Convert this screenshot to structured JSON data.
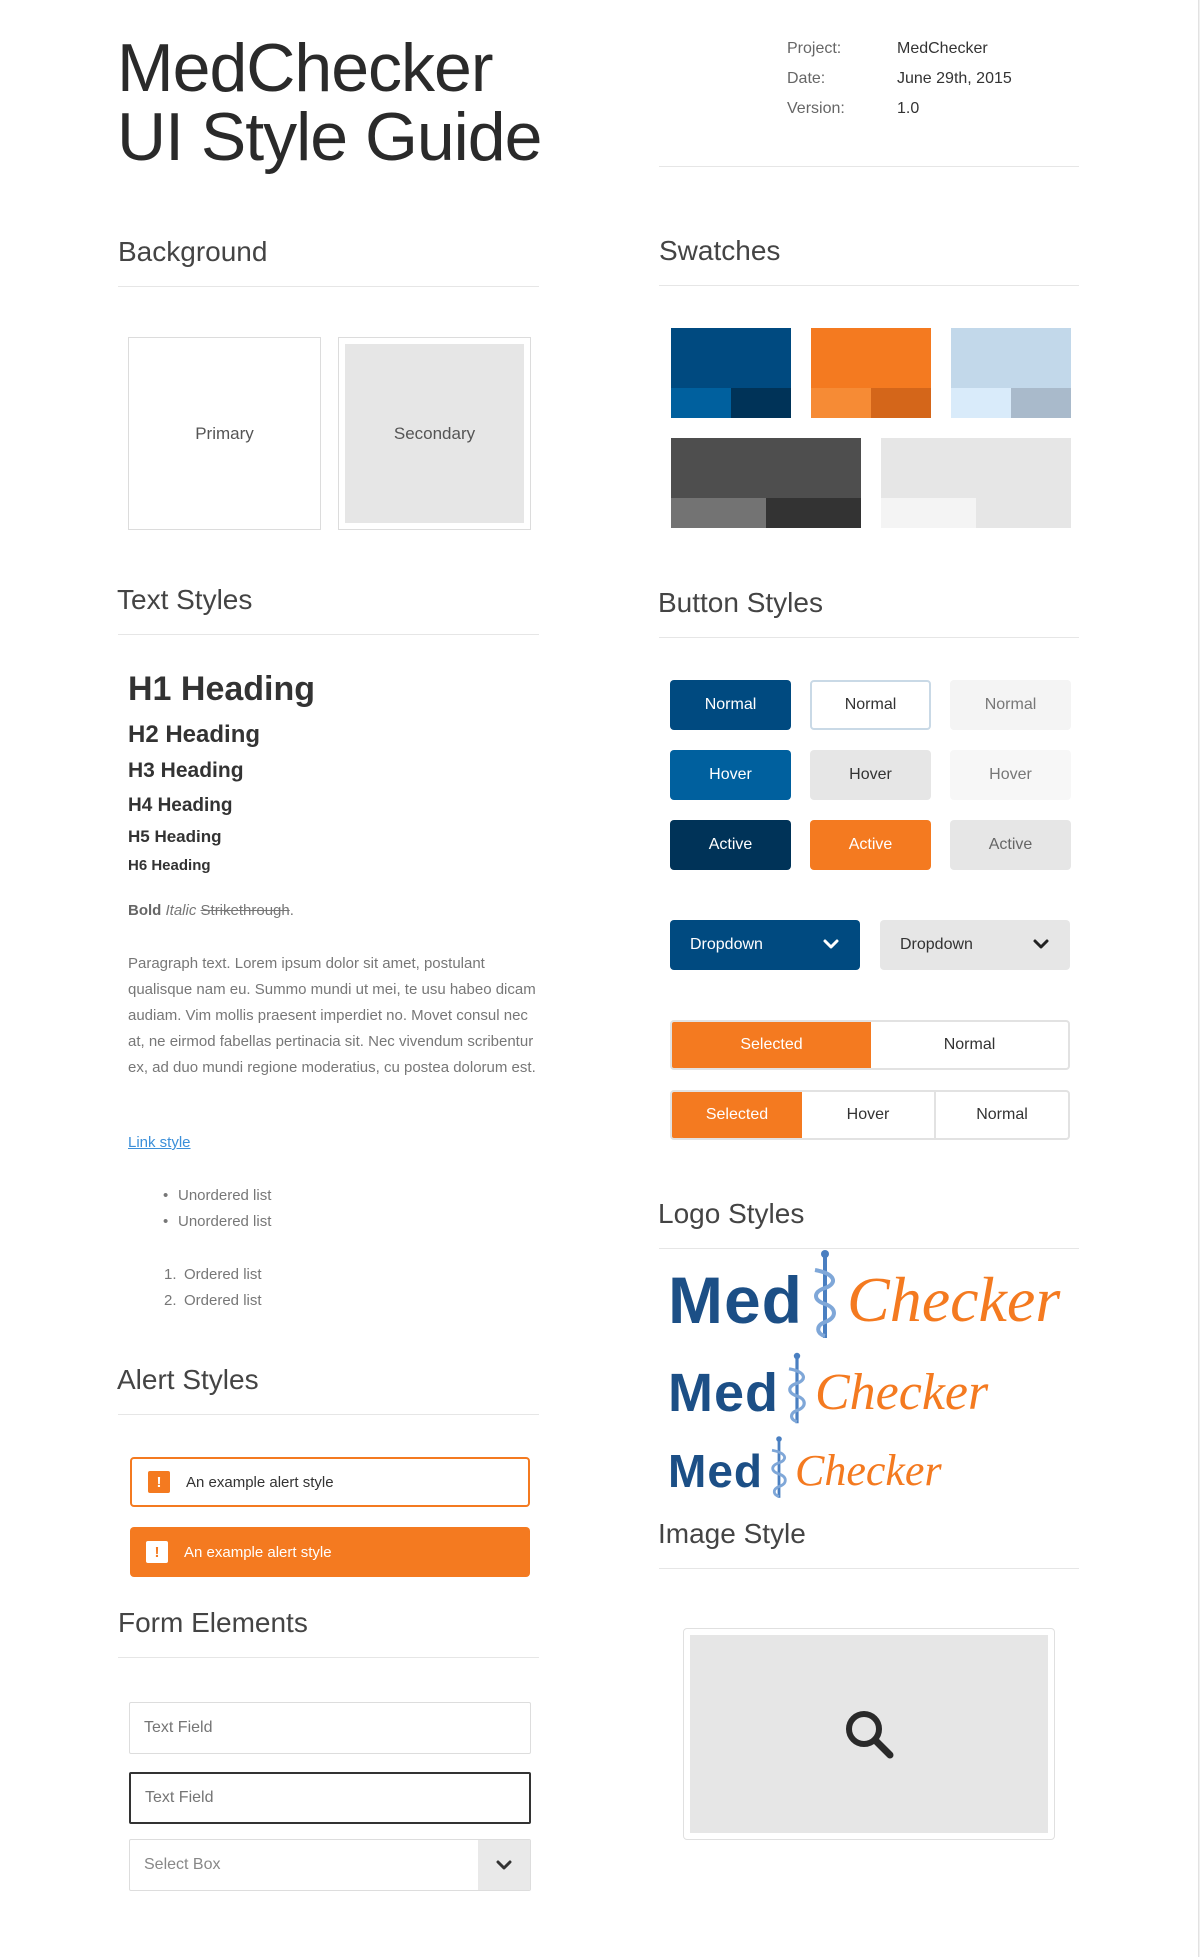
{
  "header": {
    "title_line1": "MedChecker",
    "title_line2": "UI Style Guide",
    "meta": [
      {
        "key": "Project:",
        "value": "MedChecker"
      },
      {
        "key": "Date:",
        "value": "June 29th, 2015"
      },
      {
        "key": "Version:",
        "value": "1.0"
      }
    ]
  },
  "sections": {
    "background": "Background",
    "swatches": "Swatches",
    "text_styles": "Text Styles",
    "button_styles": "Button Styles",
    "logo_styles": "Logo Styles",
    "alert_styles": "Alert Styles",
    "image_style": "Image Style",
    "form_elements": "Form Elements"
  },
  "background": {
    "primary": "Primary",
    "secondary": "Secondary"
  },
  "swatches": {
    "blue": {
      "main": "#004a80",
      "a": "#00609e",
      "b": "#003358"
    },
    "orange": {
      "main": "#f47a20",
      "a": "#f68b35",
      "b": "#d4661a"
    },
    "lightblue": {
      "main": "#c2d8ea",
      "a": "#d9ebfa",
      "b": "#a9bacb"
    },
    "darkgray": {
      "main": "#4e4e4e",
      "a": "#737373",
      "b": "#333333"
    },
    "lightgray": {
      "main": "#e6e6e6",
      "a": "#f4f4f4",
      "b": "#e6e6e6"
    }
  },
  "text_styles": {
    "h1": "H1 Heading",
    "h2": "H2 Heading",
    "h3": "H3 Heading",
    "h4": "H4 Heading",
    "h5": "H5 Heading",
    "h6": "H6 Heading",
    "bold": "Bold",
    "italic": "Italic",
    "strike": "Strikethrough",
    "period": ".",
    "paragraph": "Paragraph text. Lorem ipsum dolor sit amet, postulant qualisque nam eu. Summo mundi ut mei, te usu habeo dicam audiam. Vim mollis praesent imperdiet no. Movet consul nec at, ne eirmod fabellas pertinacia sit. Nec vivendum scribentur ex, ad duo mundi regione moderatius, cu postea dolorum est.",
    "link": "Link style",
    "unordered": [
      "Unordered list",
      "Unordered list"
    ],
    "ordered": [
      "Ordered list",
      "Ordered list"
    ],
    "ordered_nums": [
      "1.",
      "2."
    ],
    "bullet": "•"
  },
  "buttons": {
    "normal": "Normal",
    "hover": "Hover",
    "active": "Active",
    "dropdown": "Dropdown",
    "selected": "Selected"
  },
  "alerts": {
    "icon": "!",
    "text1": "An example alert style",
    "text2": "An example alert style"
  },
  "form": {
    "text_field_1": "Text Field",
    "text_field_2": "Text Field",
    "select_box": "Select Box"
  },
  "logo": {
    "med": "Med",
    "checker": "Checker"
  }
}
